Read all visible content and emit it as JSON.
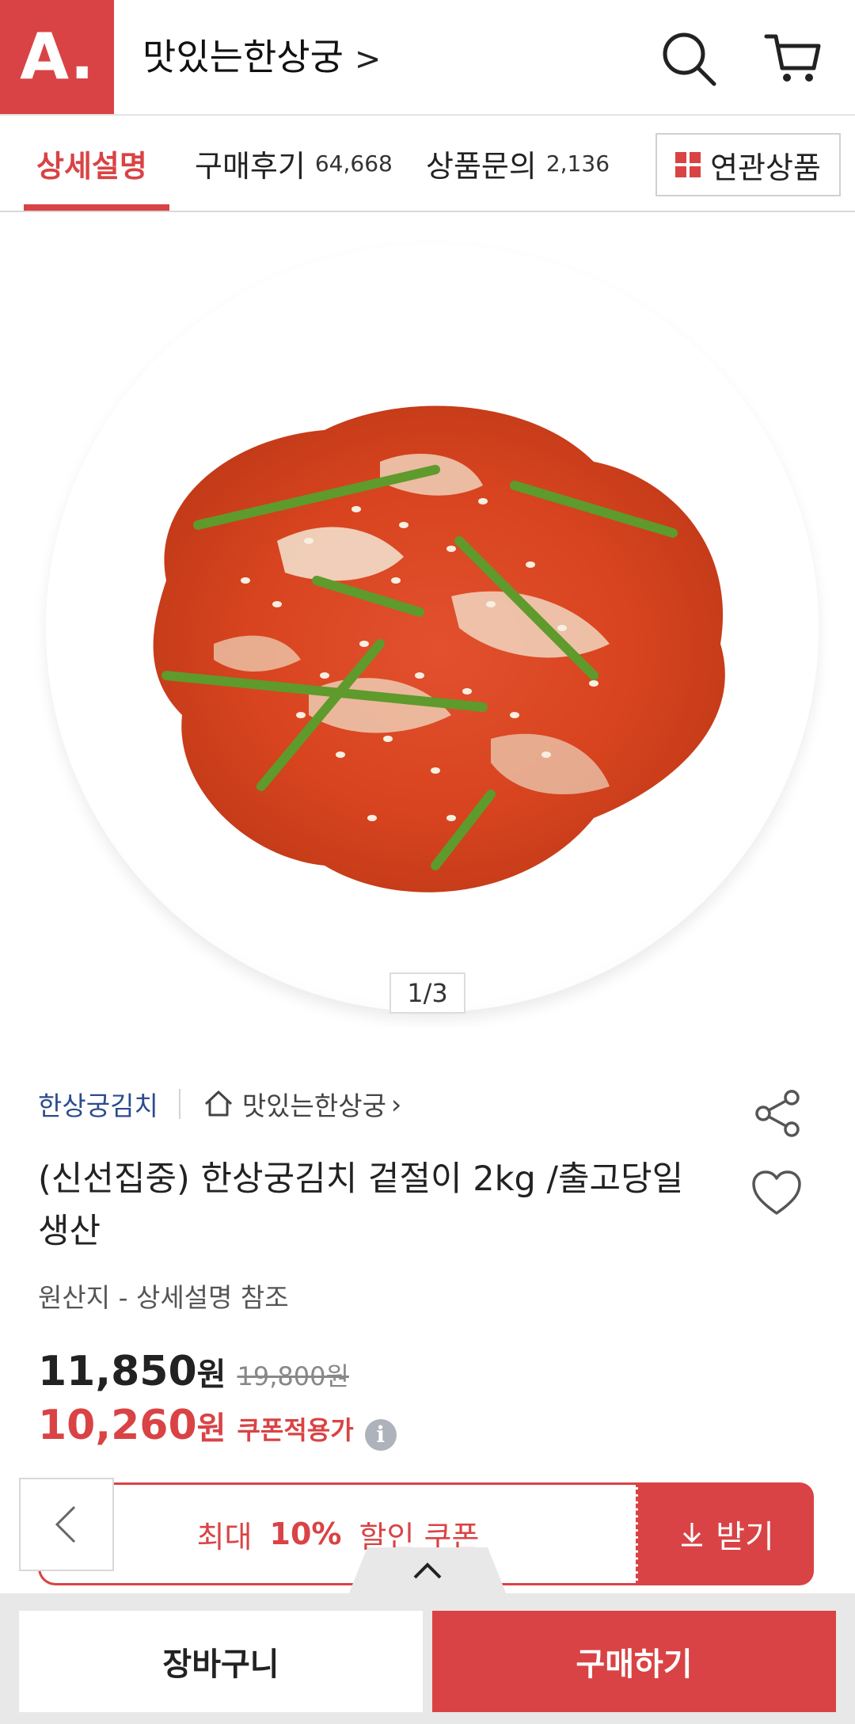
{
  "header": {
    "logo_text": "A.",
    "store_name": "맛있는한상궁",
    "store_chevron": ">",
    "search_icon": "search-icon",
    "cart_icon": "cart-icon"
  },
  "tabs": [
    {
      "label": "상세설명",
      "count": "",
      "active": true
    },
    {
      "label": "구매후기",
      "count": "64,668",
      "active": false
    },
    {
      "label": "상품문의",
      "count": "2,136",
      "active": false
    }
  ],
  "related_button": {
    "label": "연관상품",
    "icon": "grid-icon"
  },
  "gallery": {
    "counter": "1/3"
  },
  "product": {
    "brand": "한상궁김치",
    "store_link": "맛있는한상궁",
    "title": "(신선집중) 한상궁김치 겉절이 2kg /출고당일 생산",
    "origin": "원산지 - 상세설명 참조",
    "price": "11,850",
    "price_unit": "원",
    "original_price": "19,800원",
    "coupon_price": "10,260",
    "coupon_price_unit": "원",
    "coupon_price_label": "쿠폰적용가",
    "info_icon": "i"
  },
  "coupon": {
    "prefix": "최대",
    "percent": "10%",
    "suffix": "할인 쿠폰",
    "receive_label": "받기"
  },
  "bottom": {
    "cart_label": "장바구니",
    "buy_label": "구매하기"
  },
  "colors": {
    "accent": "#d94345",
    "brand_link": "#2c4b8e"
  }
}
